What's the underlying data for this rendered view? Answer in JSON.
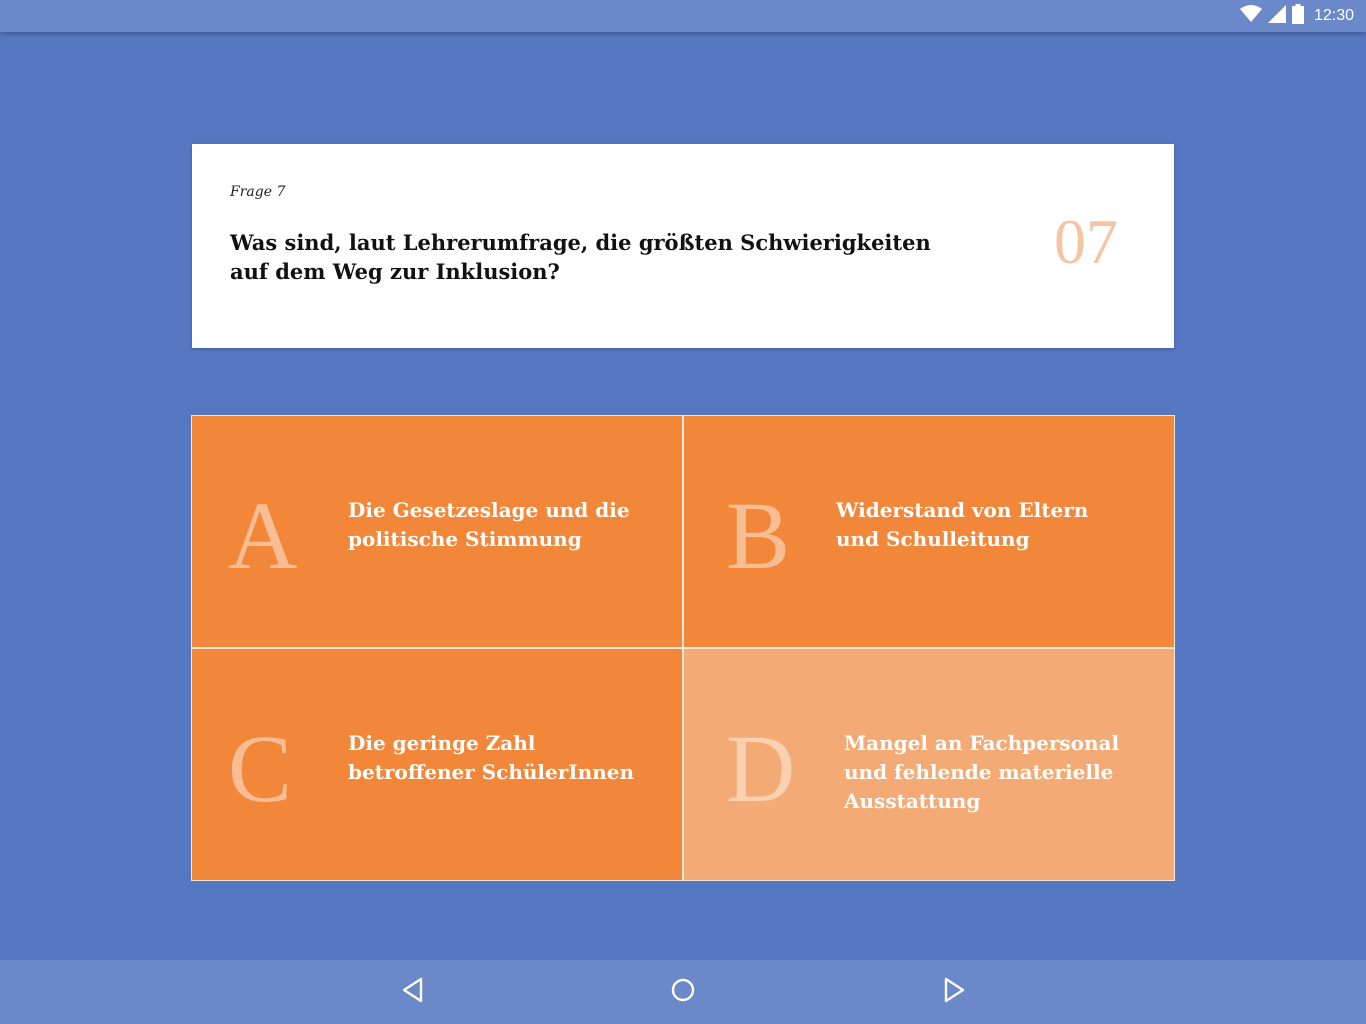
{
  "status_bar": {
    "time": "12:30",
    "icons": [
      "wifi-icon",
      "cell-signal-icon",
      "battery-icon"
    ]
  },
  "question": {
    "label": "Frage 7",
    "text": "Was sind, laut Lehrerumfrage, die größten Schwierigkeiten auf dem Weg zur Inklusion?",
    "number": "07"
  },
  "answers": [
    {
      "letter": "A",
      "text": "Die Gesetzeslage und die politische Stimmung",
      "selected": false
    },
    {
      "letter": "B",
      "text": "Widerstand von Eltern und Schulleitung",
      "selected": false
    },
    {
      "letter": "C",
      "text": "Die geringe Zahl betroffener SchülerInnen",
      "selected": false
    },
    {
      "letter": "D",
      "text": "Mangel an Fachpersonal und fehlende materielle Ausstattung",
      "selected": true
    }
  ],
  "navigation": {
    "icons": [
      "back-triangle-icon",
      "home-circle-icon",
      "forward-triangle-icon"
    ]
  },
  "colors": {
    "background": "#5677c2",
    "bars": "#6b88c9",
    "answer": "#f2873a",
    "answer_selected": "#f4aa74",
    "number": "#f6c4a3"
  }
}
